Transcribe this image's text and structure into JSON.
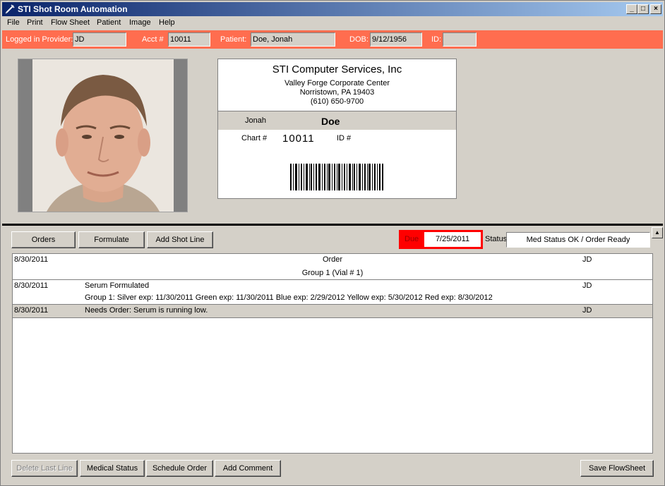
{
  "window": {
    "title": "STI Shot Room Automation"
  },
  "menu": [
    "File",
    "Print",
    "Flow Sheet",
    "Patient",
    "Image",
    "Help"
  ],
  "infobar": {
    "provider_label": "Logged in Provider:",
    "provider_value": "JD",
    "acct_label": "Acct #",
    "acct_value": "10011",
    "patient_label": "Patient:",
    "patient_value": "Doe, Jonah",
    "dob_label": "DOB:",
    "dob_value": "9/12/1956",
    "id_label": "ID:",
    "id_value": ""
  },
  "card": {
    "company": "STI Computer Services, Inc",
    "address1": "Valley Forge Corporate Center",
    "address2": "Norristown, PA 19403",
    "phone": "(610) 650-9700",
    "first_name": "Jonah",
    "last_name": "Doe",
    "chart_label": "Chart #",
    "chart_value": "10011",
    "id_label": "ID #"
  },
  "toolbar": {
    "orders": "Orders",
    "formulate": "Formulate",
    "add_shot_line": "Add Shot Line",
    "due_label": "Due",
    "due_value": "7/25/2011",
    "status_label": "Status",
    "status_value": "Med Status OK / Order Ready"
  },
  "rows": [
    {
      "date": "8/30/2011",
      "title": "Order",
      "sub": "Group 1 (Vial # 1)",
      "user": "JD"
    },
    {
      "date": "8/30/2011",
      "title": "Serum Formulated",
      "sub": "Group 1:   Silver exp: 11/30/2011  Green exp: 11/30/2011  Blue exp: 2/29/2012  Yellow exp: 5/30/2012  Red exp: 8/30/2012",
      "user": "JD"
    },
    {
      "date": "8/30/2011",
      "title": "Needs Order:  Serum is running low.",
      "user": "JD"
    }
  ],
  "bottom": {
    "delete_last_line": "Delete Last Line",
    "medical_status": "Medical Status",
    "schedule_order": "Schedule Order",
    "add_comment": "Add Comment",
    "save_flowsheet": "Save FlowSheet"
  }
}
